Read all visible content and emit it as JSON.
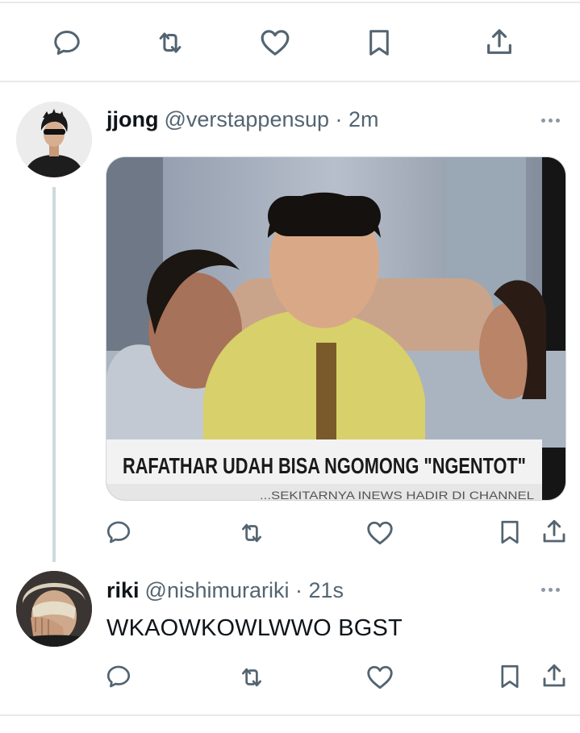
{
  "top_actions": {
    "icons": [
      "reply-icon",
      "retweet-icon",
      "like-icon",
      "bookmark-icon",
      "share-icon"
    ]
  },
  "tweet1": {
    "author_name": "jjong",
    "handle_time": "@verstappensup · 2m",
    "media": {
      "caption": "RAFATHAR UDAH BISA NGOMONG \"NGENTOT\"",
      "ticker": "...SEKITARNYA  INEWS HADIR DI CHANNEL"
    },
    "actions": [
      "reply-icon",
      "retweet-icon",
      "like-icon",
      "bookmark-icon",
      "share-icon"
    ]
  },
  "tweet2": {
    "author_name": "riki",
    "handle_time": "@nishimurariki · 21s",
    "text": "WKAOWKOWLWWO BGST",
    "actions": [
      "reply-icon",
      "retweet-icon",
      "like-icon",
      "bookmark-icon",
      "share-icon"
    ]
  },
  "colors": {
    "text": "#0f1419",
    "secondary": "#536471",
    "divider": "#e7e9ea",
    "thread_line": "#cfd9de",
    "icon": "#536471"
  }
}
